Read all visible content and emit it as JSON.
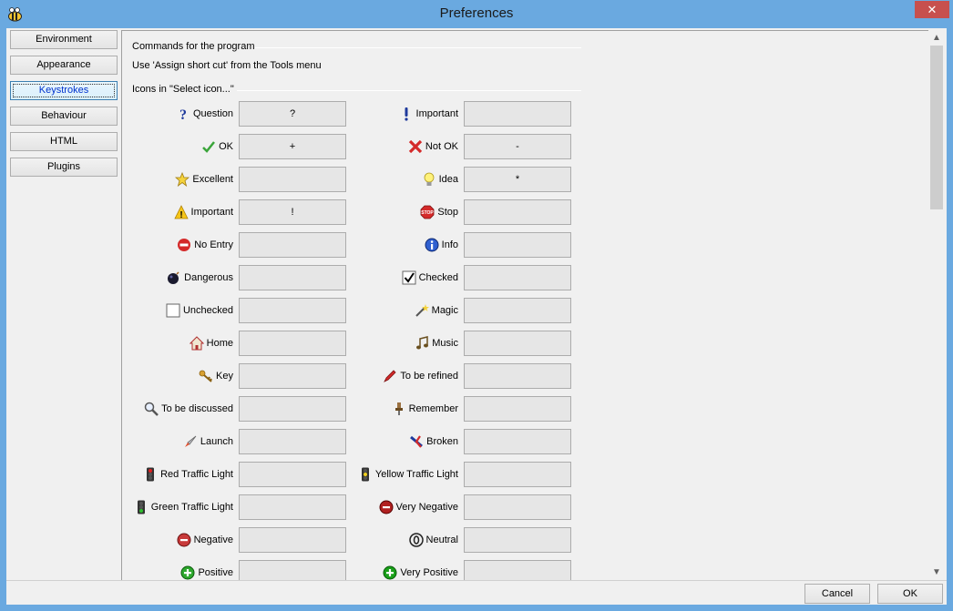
{
  "window": {
    "title": "Preferences",
    "close_label": "✕"
  },
  "nav": {
    "items": [
      {
        "label": "Environment"
      },
      {
        "label": "Appearance"
      },
      {
        "label": "Keystrokes",
        "active": true
      },
      {
        "label": "Behaviour"
      },
      {
        "label": "HTML"
      },
      {
        "label": "Plugins"
      }
    ]
  },
  "commands": {
    "heading": "Commands for the program",
    "note": "Use 'Assign short cut' from the Tools menu"
  },
  "icons": {
    "heading": "Icons in \"Select icon...\"",
    "left": [
      {
        "label": "Question",
        "icon": "question-icon",
        "key": "?"
      },
      {
        "label": "OK",
        "icon": "ok-check-icon",
        "key": "+"
      },
      {
        "label": "Excellent",
        "icon": "star-icon",
        "key": ""
      },
      {
        "label": "Important",
        "icon": "warning-icon",
        "key": "!"
      },
      {
        "label": "No Entry",
        "icon": "no-entry-icon",
        "key": ""
      },
      {
        "label": "Dangerous",
        "icon": "bomb-icon",
        "key": ""
      },
      {
        "label": "Unchecked",
        "icon": "unchecked-box-icon",
        "key": ""
      },
      {
        "label": "Home",
        "icon": "home-icon",
        "key": ""
      },
      {
        "label": "Key",
        "icon": "key-icon",
        "key": ""
      },
      {
        "label": "To be discussed",
        "icon": "magnifier-icon",
        "key": ""
      },
      {
        "label": "Launch",
        "icon": "rocket-icon",
        "key": ""
      },
      {
        "label": "Red Traffic Light",
        "icon": "red-traffic-light-icon",
        "key": ""
      },
      {
        "label": "Green Traffic Light",
        "icon": "green-traffic-light-icon",
        "key": ""
      },
      {
        "label": "Negative",
        "icon": "negative-icon",
        "key": ""
      },
      {
        "label": "Positive",
        "icon": "positive-icon",
        "key": ""
      }
    ],
    "right": [
      {
        "label": "Important",
        "icon": "exclamation-icon",
        "key": ""
      },
      {
        "label": "Not OK",
        "icon": "red-x-icon",
        "key": "-"
      },
      {
        "label": "Idea",
        "icon": "lightbulb-icon",
        "key": "*"
      },
      {
        "label": "Stop",
        "icon": "stop-sign-icon",
        "key": ""
      },
      {
        "label": "Info",
        "icon": "info-icon",
        "key": ""
      },
      {
        "label": "Checked",
        "icon": "checked-box-icon",
        "key": ""
      },
      {
        "label": "Magic",
        "icon": "magic-wand-icon",
        "key": ""
      },
      {
        "label": "Music",
        "icon": "music-icon",
        "key": ""
      },
      {
        "label": "To be refined",
        "icon": "pen-icon",
        "key": ""
      },
      {
        "label": "Remember",
        "icon": "pin-icon",
        "key": ""
      },
      {
        "label": "Broken",
        "icon": "broken-icon",
        "key": ""
      },
      {
        "label": "Yellow Traffic Light",
        "icon": "yellow-traffic-light-icon",
        "key": ""
      },
      {
        "label": "Very Negative",
        "icon": "very-negative-icon",
        "key": ""
      },
      {
        "label": "Neutral",
        "icon": "neutral-icon",
        "key": ""
      },
      {
        "label": "Very Positive",
        "icon": "very-positive-icon",
        "key": ""
      }
    ]
  },
  "footer": {
    "cancel_label": "Cancel",
    "ok_label": "OK"
  }
}
